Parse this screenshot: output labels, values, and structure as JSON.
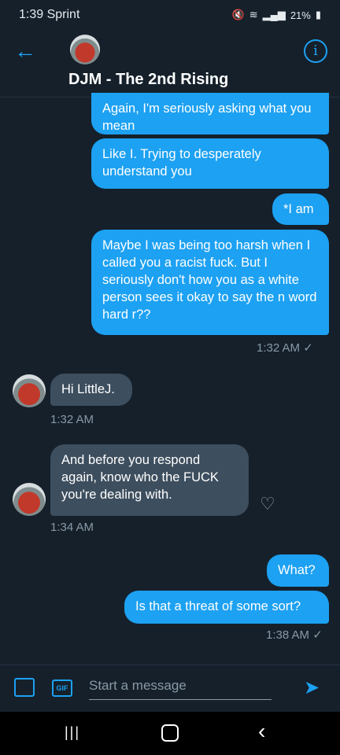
{
  "status_bar": {
    "time_carrier": "1:39 Sprint",
    "battery": "21%"
  },
  "header": {
    "title": "DJM - The 2nd Rising",
    "back_icon": "arrow-left-icon",
    "info_icon": "info-icon"
  },
  "messages": [
    {
      "direction": "out",
      "text": "Again, I'm seriously asking what you mean"
    },
    {
      "direction": "out",
      "text": "Like I. Trying to desperately understand you"
    },
    {
      "direction": "out",
      "text": "*I am"
    },
    {
      "direction": "out",
      "text": "Maybe I was being too harsh when I called you a racist fuck. But I seriously don't how you as a white person sees it okay to say the n word hard r??"
    },
    {
      "direction": "out",
      "timestamp": "1:32 AM ✓"
    },
    {
      "direction": "in",
      "text": "Hi LittleJ."
    },
    {
      "direction": "in",
      "timestamp": "1:32 AM"
    },
    {
      "direction": "in",
      "text": "And before you respond again, know who the FUCK you're dealing with."
    },
    {
      "direction": "in",
      "timestamp": "1:34 AM"
    },
    {
      "direction": "out",
      "text": "What?"
    },
    {
      "direction": "out",
      "text": "Is that a threat of some sort?"
    },
    {
      "direction": "out",
      "timestamp": "1:38 AM ✓"
    }
  ],
  "composer": {
    "placeholder": "Start a message",
    "gif_label": "GIF"
  },
  "colors": {
    "accent": "#1da1f2",
    "background": "#15202b",
    "incoming_bubble": "#3d4e5e"
  }
}
